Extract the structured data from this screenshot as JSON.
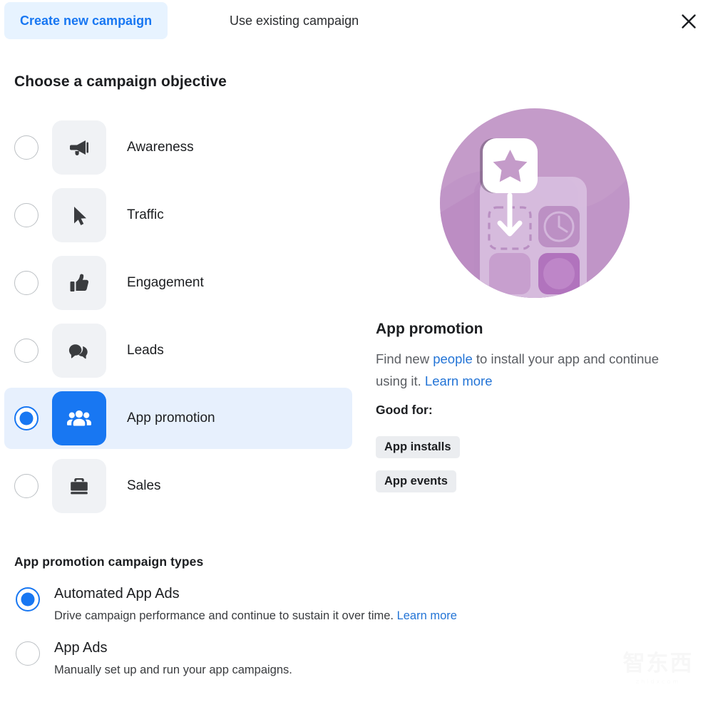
{
  "header": {
    "tabs": [
      {
        "label": "Create new campaign",
        "active": true
      },
      {
        "label": "Use existing campaign",
        "active": false
      }
    ],
    "close_icon": "close-icon",
    "accent_color": "#1877F2",
    "active_tab_bg": "#E7F3FF"
  },
  "objective_section": {
    "title": "Choose a campaign objective",
    "options": [
      {
        "label": "Awareness",
        "icon": "megaphone-icon",
        "selected": false
      },
      {
        "label": "Traffic",
        "icon": "cursor-icon",
        "selected": false
      },
      {
        "label": "Engagement",
        "icon": "thumbs-up-icon",
        "selected": false
      },
      {
        "label": "Leads",
        "icon": "chat-bubbles-icon",
        "selected": false
      },
      {
        "label": "App promotion",
        "icon": "people-icon",
        "selected": true
      },
      {
        "label": "Sales",
        "icon": "briefcase-icon",
        "selected": false
      }
    ],
    "selected_row_bg": "#E7F0FD"
  },
  "detail_panel": {
    "illustration": "app-promotion-illustration",
    "title": "App promotion",
    "description_part1": "Find new ",
    "description_link1": "people",
    "description_part2": " to install your app and continue using it. ",
    "description_link2": "Learn more",
    "good_for_label": "Good for:",
    "tags": [
      "App installs",
      "App events"
    ]
  },
  "campaign_types": {
    "title": "App promotion campaign types",
    "options": [
      {
        "label": "Automated App Ads",
        "description": "Drive campaign performance and continue to sustain it over time. ",
        "link": "Learn more",
        "selected": true
      },
      {
        "label": "App Ads",
        "description": "Manually set up and run your app campaigns.",
        "link": "",
        "selected": false
      }
    ]
  },
  "watermark": {
    "text": "智东西",
    "subtext": "zhidxcom"
  }
}
